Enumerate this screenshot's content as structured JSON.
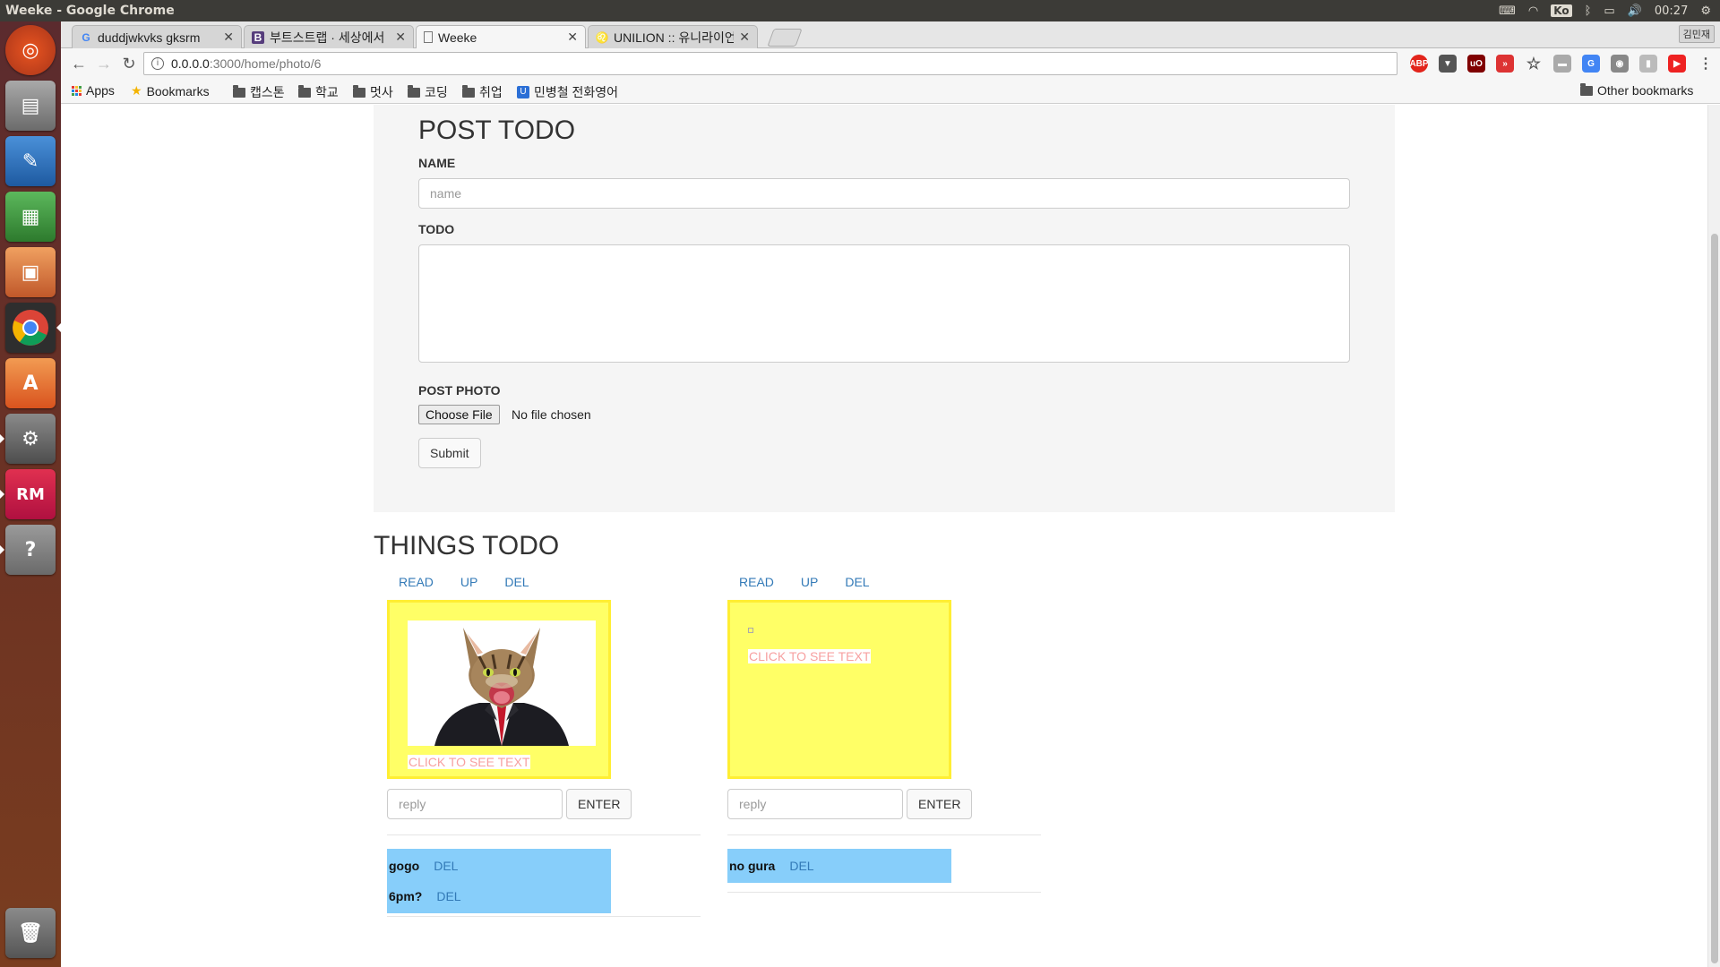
{
  "os": {
    "window_title": "Weeke - Google Chrome",
    "keyboard_indicator": "Ko",
    "clock": "00:27"
  },
  "tabs": [
    {
      "title": "duddjwkvks gksrm",
      "favicon": "google-icon",
      "active": false
    },
    {
      "title": "부트스트랩 · 세상에서",
      "favicon": "bootstrap-icon",
      "active": false
    },
    {
      "title": "Weeke",
      "favicon": "page-icon",
      "active": true
    },
    {
      "title": "UNILION :: 유니라이언",
      "favicon": "lion-icon",
      "active": false
    }
  ],
  "profile_button": "김민재",
  "address_bar": {
    "host": "0.0.0.0",
    "path": ":3000/home/photo/6"
  },
  "bookmarks": {
    "apps": "Apps",
    "bookmarks": "Bookmarks",
    "folders": [
      "캡스톤",
      "학교",
      "멋사",
      "코딩",
      "취업"
    ],
    "link": "민병철 전화영어",
    "other": "Other bookmarks"
  },
  "post_form": {
    "title": "POST TODO",
    "name_label": "NAME",
    "name_placeholder": "name",
    "todo_label": "TODO",
    "photo_label": "POST PHOTO",
    "choose_file": "Choose File",
    "no_file": "No file chosen",
    "submit": "Submit"
  },
  "things_todo": {
    "title": "THINGS TODO",
    "cards": [
      {
        "read": "READ",
        "up": "UP",
        "del": "DEL",
        "has_photo": true,
        "click_text": "CLICK TO SEE TEXT",
        "reply_placeholder": "reply",
        "enter": "ENTER",
        "replies": [
          {
            "name": "gogo",
            "del": "DEL"
          },
          {
            "name": "6pm?",
            "del": "DEL"
          }
        ]
      },
      {
        "read": "READ",
        "up": "UP",
        "del": "DEL",
        "has_photo": false,
        "click_text": "CLICK TO SEE TEXT",
        "reply_placeholder": "reply",
        "enter": "ENTER",
        "replies": [
          {
            "name": "no gura",
            "del": "DEL"
          }
        ]
      }
    ]
  },
  "colors": {
    "sticky": "#ffff66",
    "reply_bg": "#87cefa",
    "link": "#337ab7",
    "click_text": "#f7a0a0"
  }
}
